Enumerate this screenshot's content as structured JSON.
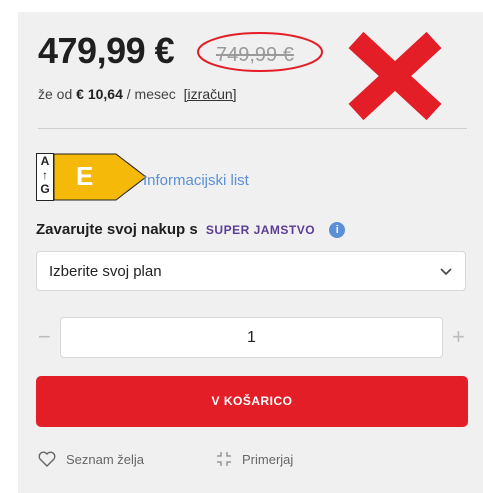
{
  "price": {
    "current": "479,99 €",
    "old": "749,99 €",
    "monthly_prefix": "že od",
    "monthly_amount": "€ 10,64",
    "monthly_suffix": "/ mesec",
    "calc_link": "[izračun]"
  },
  "energy": {
    "scale_top": "A",
    "scale_arrow": "↑",
    "scale_bottom": "G",
    "class": "E",
    "class_color": "#f5b90a",
    "info_link": "Informacijski list"
  },
  "insurance": {
    "label": "Zavarujte svoj nakup s",
    "brand": "SUPER JAMSTVO",
    "info_icon": "i"
  },
  "plan_select": {
    "value": "Izberite svoj plan",
    "icon": "chevron-down-icon"
  },
  "quantity": {
    "minus": "−",
    "value": "1",
    "plus": "+"
  },
  "cart_button": {
    "label": "V KOŠARICO",
    "color": "#e31e26"
  },
  "actions": {
    "wishlist": "Seznam želja",
    "compare": "Primerjaj"
  },
  "annotation_colors": {
    "circle": "#e31e26",
    "cross": "#e31e26"
  }
}
